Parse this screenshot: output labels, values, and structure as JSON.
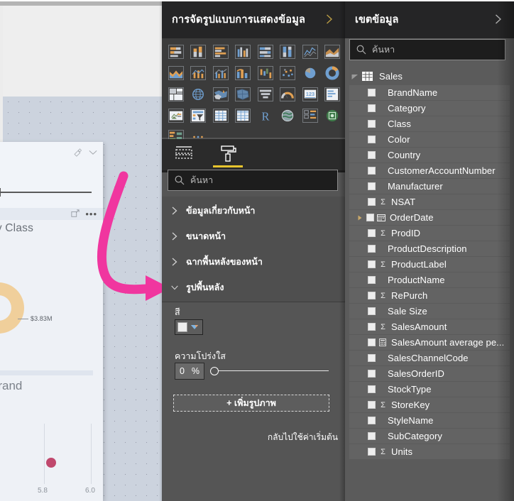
{
  "canvas": {
    "chart_title_class": "by Class",
    "chart_title_brand": "Brand",
    "data_label": "$3.83M",
    "axis_tick_left": "5.8",
    "axis_tick_right": "6.0",
    "eraser_icon": "eraser-icon",
    "chevron_icon": "chevron-down-icon",
    "focus_icon": "focus-mode-icon",
    "more_icon": "more-options-icon"
  },
  "visualizations": {
    "header_title": "การจัดรูปแบบการแสดงข้อมูล",
    "collapse_icon": "chevron-right-icon",
    "gallery": [
      {
        "name": "stacked-bar-chart-icon"
      },
      {
        "name": "stacked-column-chart-icon"
      },
      {
        "name": "clustered-bar-chart-icon"
      },
      {
        "name": "clustered-column-chart-icon"
      },
      {
        "name": "100-percent-stacked-bar-chart-icon"
      },
      {
        "name": "100-percent-stacked-column-chart-icon"
      },
      {
        "name": "line-chart-icon"
      },
      {
        "name": "area-chart-icon"
      },
      {
        "name": "stacked-area-chart-icon"
      },
      {
        "name": "line-and-stacked-column-chart-icon"
      },
      {
        "name": "line-and-clustered-column-chart-icon"
      },
      {
        "name": "ribbon-chart-icon"
      },
      {
        "name": "waterfall-chart-icon"
      },
      {
        "name": "scatter-chart-icon"
      },
      {
        "name": "pie-chart-icon"
      },
      {
        "name": "donut-chart-icon"
      },
      {
        "name": "treemap-icon"
      },
      {
        "name": "map-icon"
      },
      {
        "name": "filled-map-icon"
      },
      {
        "name": "shape-map-icon"
      },
      {
        "name": "funnel-chart-icon"
      },
      {
        "name": "gauge-chart-icon"
      },
      {
        "name": "card-icon"
      },
      {
        "name": "multi-row-card-icon"
      },
      {
        "name": "kpi-icon"
      },
      {
        "name": "slicer-icon"
      },
      {
        "name": "table-icon"
      },
      {
        "name": "matrix-icon"
      },
      {
        "name": "r-script-visual-icon"
      },
      {
        "name": "arcgis-map-icon"
      },
      {
        "name": "key-influencers-icon"
      },
      {
        "name": "python-visual-icon"
      },
      {
        "name": "decomposition-tree-icon"
      },
      {
        "name": "more-visuals-icon"
      }
    ],
    "tabs": [
      {
        "name": "fields-tab",
        "icon": "fields-grid-icon",
        "active": false
      },
      {
        "name": "format-tab",
        "icon": "paint-roller-icon",
        "active": true
      }
    ],
    "search_placeholder": "ค้นหา",
    "search_value": "",
    "search_icon": "search-icon",
    "accordions": [
      {
        "label": "ข้อมูลเกี่ยวกับหน้า",
        "expanded": false,
        "icon": "chevron-right-icon"
      },
      {
        "label": "ขนาดหน้า",
        "expanded": false,
        "icon": "chevron-right-icon"
      },
      {
        "label": "ฉากพื้นหลังของหน้า",
        "expanded": false,
        "icon": "chevron-right-icon"
      },
      {
        "label": "รูปพื้นหลัง",
        "expanded": true,
        "icon": "chevron-down-icon"
      }
    ],
    "background_section": {
      "color_label": "สี",
      "color_value": "#ededed",
      "color_dropdown_icon": "color-picker-chevron-icon",
      "transparency_label": "ความโปร่งใส",
      "transparency_value": "0",
      "transparency_unit": "%",
      "transparency_percent": 0,
      "add_image_label": "+ เพิ่มรูปภาพ",
      "reset_label": "กลับไปใช้ค่าเริ่มต้น"
    },
    "accent_color": "#e8c52e"
  },
  "fields": {
    "header_title": "เขตข้อมูล",
    "collapse_icon": "chevron-right-icon",
    "search_placeholder": "ค้นหา",
    "search_value": "",
    "search_icon": "search-icon",
    "table": {
      "name": "Sales",
      "icon": "table-icon",
      "caret_icon": "caret-down-icon",
      "expanded": true
    },
    "items": [
      {
        "label": "BrandName",
        "aggregate": false,
        "date": false,
        "expandable": false
      },
      {
        "label": "Category",
        "aggregate": false,
        "date": false,
        "expandable": false
      },
      {
        "label": "Class",
        "aggregate": false,
        "date": false,
        "expandable": false
      },
      {
        "label": "Color",
        "aggregate": false,
        "date": false,
        "expandable": false
      },
      {
        "label": "Country",
        "aggregate": false,
        "date": false,
        "expandable": false
      },
      {
        "label": "CustomerAccountNumber",
        "aggregate": false,
        "date": false,
        "expandable": false
      },
      {
        "label": "Manufacturer",
        "aggregate": false,
        "date": false,
        "expandable": false
      },
      {
        "label": "NSAT",
        "aggregate": true,
        "date": false,
        "expandable": false
      },
      {
        "label": "OrderDate",
        "aggregate": false,
        "date": true,
        "expandable": true
      },
      {
        "label": "ProdID",
        "aggregate": true,
        "date": false,
        "expandable": false
      },
      {
        "label": "ProductDescription",
        "aggregate": false,
        "date": false,
        "expandable": false
      },
      {
        "label": "ProductLabel",
        "aggregate": true,
        "date": false,
        "expandable": false
      },
      {
        "label": "ProductName",
        "aggregate": false,
        "date": false,
        "expandable": false
      },
      {
        "label": "RePurch",
        "aggregate": true,
        "date": false,
        "expandable": false
      },
      {
        "label": "Sale Size",
        "aggregate": false,
        "date": false,
        "expandable": false
      },
      {
        "label": "SalesAmount",
        "aggregate": true,
        "date": false,
        "expandable": false
      },
      {
        "label": "SalesAmount average pe...",
        "aggregate": false,
        "date": false,
        "measure": true,
        "expandable": false
      },
      {
        "label": "SalesChannelCode",
        "aggregate": false,
        "date": false,
        "expandable": false
      },
      {
        "label": "SalesOrderID",
        "aggregate": false,
        "date": false,
        "expandable": false
      },
      {
        "label": "StockType",
        "aggregate": false,
        "date": false,
        "expandable": false
      },
      {
        "label": "StoreKey",
        "aggregate": true,
        "date": false,
        "expandable": false
      },
      {
        "label": "StyleName",
        "aggregate": false,
        "date": false,
        "expandable": false
      },
      {
        "label": "SubCategory",
        "aggregate": false,
        "date": false,
        "expandable": false
      },
      {
        "label": "Units",
        "aggregate": true,
        "date": false,
        "expandable": false
      }
    ]
  },
  "annotation": {
    "arrow_color": "#f0369f",
    "name": "pink-callout-arrow"
  },
  "chart_data": {
    "type": "scatter",
    "title": "by Class",
    "annotations": [
      "$3.83M"
    ],
    "x": [
      5.87
    ],
    "y": [
      0.32
    ],
    "xlabel": "",
    "ylabel": "",
    "xticks": [
      "5.8",
      "6.0"
    ],
    "xlim": [
      5.75,
      6.05
    ],
    "grid": false,
    "legend": "none"
  }
}
